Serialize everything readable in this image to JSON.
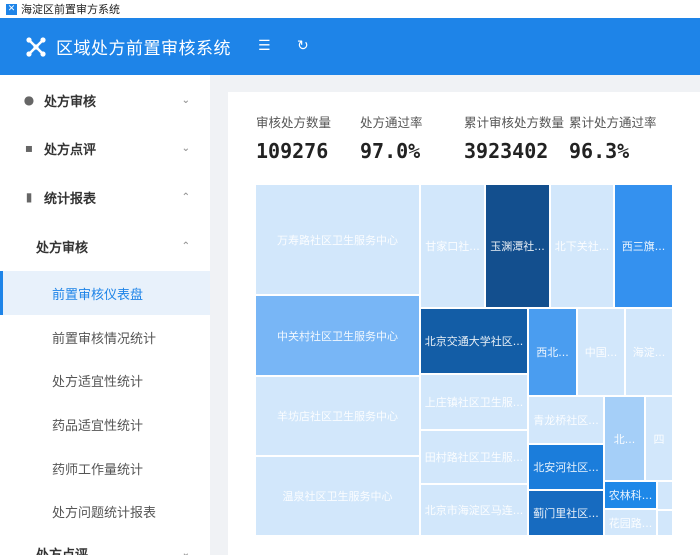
{
  "window": {
    "title": "海淀区前置审方系统"
  },
  "header": {
    "title": "区域处方前置审核系统"
  },
  "sidebar": {
    "items": [
      {
        "label": "处方审核",
        "icon": "user-icon",
        "chev": "⌄"
      },
      {
        "label": "处方点评",
        "icon": "comment-icon",
        "chev": "⌄"
      },
      {
        "label": "统计报表",
        "icon": "bar-chart-icon",
        "chev": "⌃"
      },
      {
        "label": "处方审核",
        "chev": "⌃"
      },
      {
        "label": "前置审核仪表盘"
      },
      {
        "label": "前置审核情况统计"
      },
      {
        "label": "处方适宜性统计"
      },
      {
        "label": "药品适宜性统计"
      },
      {
        "label": "药师工作量统计"
      },
      {
        "label": "处方问题统计报表"
      },
      {
        "label": "处方点评",
        "chev": "⌄"
      }
    ]
  },
  "stats": [
    {
      "label": "审核处方数量",
      "value": "109276"
    },
    {
      "label": "处方通过率",
      "value": "97.0%"
    },
    {
      "label": "累计审核处方数量",
      "value": "3923402"
    },
    {
      "label": "累计处方通过率",
      "value": "96.3%"
    }
  ],
  "treemap": [
    {
      "name": "万寿路社区卫生服务中心",
      "color": "#d2e7fb"
    },
    {
      "name": "中关村社区卫生服务中心",
      "color": "#78b6f6"
    },
    {
      "name": "羊坊店社区卫生服务中心",
      "color": "#d2e7fb"
    },
    {
      "name": "温泉社区卫生服务中心",
      "color": "#d2e7fb"
    },
    {
      "name": "甘家口社...",
      "color": "#d2e7fb"
    },
    {
      "name": "玉渊潭社...",
      "color": "#134f8e"
    },
    {
      "name": "北下关社...",
      "color": "#d2e7fb"
    },
    {
      "name": "西三旗...",
      "color": "#3491ef"
    },
    {
      "name": "北京交通大学社区...",
      "color": "#135da6"
    },
    {
      "name": "西北...",
      "color": "#4a9df0"
    },
    {
      "name": "中国...",
      "color": "#d2e7fb"
    },
    {
      "name": "海淀...",
      "color": "#d2e7fb"
    },
    {
      "name": "上庄镇社区卫生服...",
      "color": "#d2e7fb"
    },
    {
      "name": "田村路社区卫生服...",
      "color": "#d2e7fb"
    },
    {
      "name": "北京市海淀区马连...",
      "color": "#d2e7fb"
    },
    {
      "name": "青龙桥社区...",
      "color": "#d2e7fb"
    },
    {
      "name": "北安河社区...",
      "color": "#1b7ddb"
    },
    {
      "name": "蓟门里社区...",
      "color": "#176bc0"
    },
    {
      "name": "北...",
      "color": "#a5cff8"
    },
    {
      "name": "四",
      "color": "#d2e7fb"
    },
    {
      "name": "农林科...",
      "color": "#1e88e8"
    },
    {
      "name": "花园路...",
      "color": "#d2e7fb"
    },
    {
      "name": "",
      "color": "#d2e7fb"
    },
    {
      "name": "",
      "color": "#d2e7fb"
    }
  ]
}
